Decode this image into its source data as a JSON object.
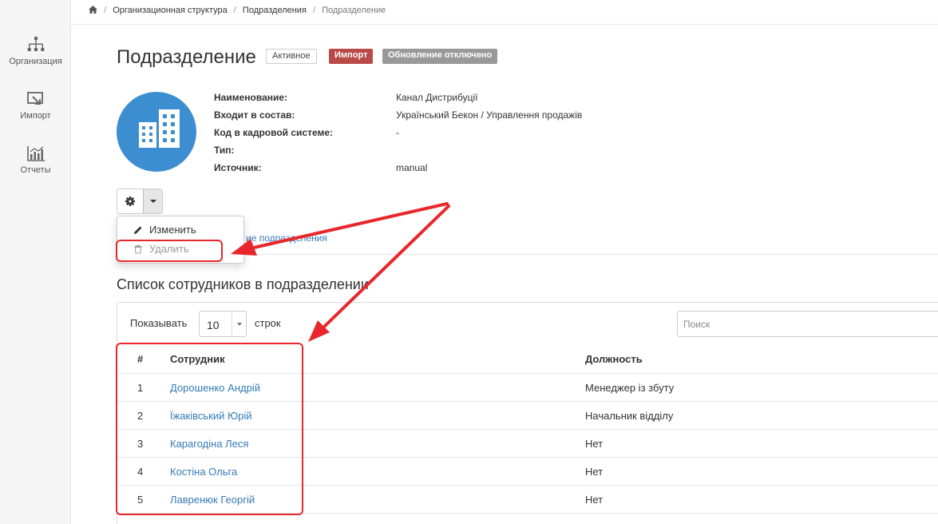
{
  "sidebar": {
    "items": [
      {
        "label": "Организация",
        "icon": "org-chart-icon"
      },
      {
        "label": "Импорт",
        "icon": "import-icon"
      },
      {
        "label": "Отчеты",
        "icon": "reports-chart-icon"
      }
    ]
  },
  "breadcrumb": {
    "home_icon": "home-icon",
    "items": [
      "Организационная структура",
      "Подразделения",
      "Подразделение"
    ]
  },
  "header": {
    "title": "Подразделение",
    "badges": {
      "status": "Активное",
      "import": "Импорт",
      "update": "Обновление отключено"
    }
  },
  "details": {
    "rows": [
      {
        "key": "Наименование:",
        "value": "Канал Дистрибуції"
      },
      {
        "key": "Входит в состав:",
        "value": "Український Бекон / Управлення продажів"
      },
      {
        "key": "Код в кадровой системе:",
        "value": "-"
      },
      {
        "key": "Тип:",
        "value": ""
      },
      {
        "key": "Источник:",
        "value": "manual"
      }
    ]
  },
  "actions": {
    "gear_icon": "gear-icon",
    "caret_icon": "caret-down-icon",
    "menu": [
      {
        "label": "Изменить",
        "icon": "pencil-icon"
      },
      {
        "label": "Удалить",
        "icon": "trash-icon"
      }
    ],
    "partial_link": "ие подразделения"
  },
  "employees": {
    "title": "Список сотрудников в подразделении",
    "show_label": "Показывать",
    "page_length": "10",
    "rows_label": "строк",
    "search_placeholder": "Поиск",
    "columns": [
      "#",
      "Сотрудник",
      "Должность"
    ],
    "rows": [
      {
        "num": "1",
        "name": "Дорошенко Андрій",
        "position": "Менеджер із збуту"
      },
      {
        "num": "2",
        "name": "Їжаківський Юрій",
        "position": "Начальник відділу"
      },
      {
        "num": "3",
        "name": "Карагодіна Леся",
        "position": "Нет"
      },
      {
        "num": "4",
        "name": "Костіна Ольга",
        "position": "Нет"
      },
      {
        "num": "5",
        "name": "Лавренюк Георгій",
        "position": "Нет"
      }
    ]
  },
  "colors": {
    "link": "#337ab7",
    "import_badge": "#b94a48",
    "disabled_badge": "#999999",
    "avatar": "#3d8ed0",
    "annotation": "#e8272c"
  }
}
